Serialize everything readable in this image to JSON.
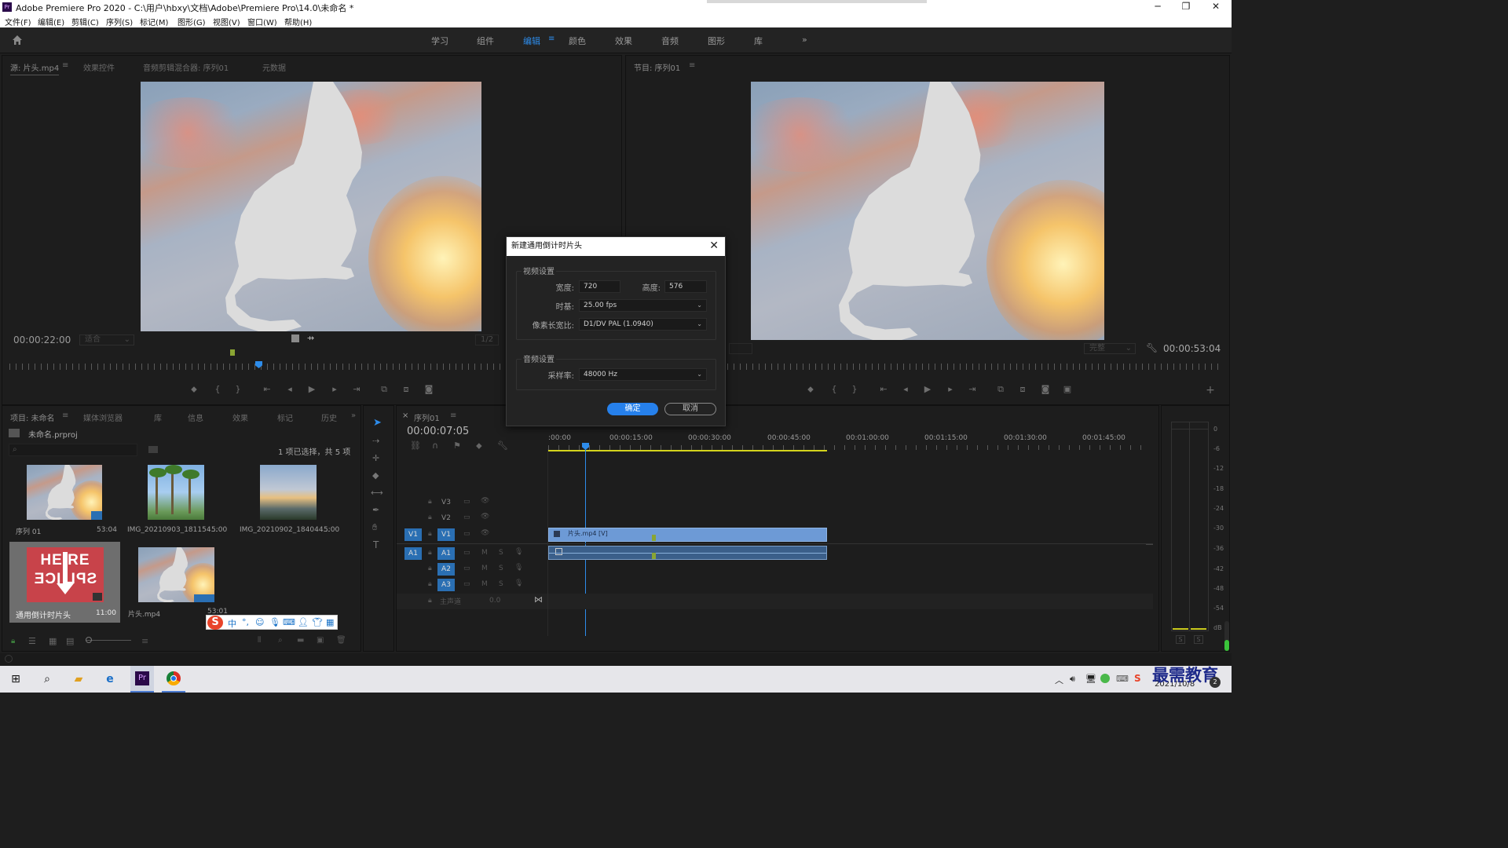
{
  "titlebar": {
    "title": "Adobe Premiere Pro 2020 - C:\\用户\\hbxy\\文档\\Adobe\\Premiere Pro\\14.0\\未命名 *",
    "app_icon": "Pr",
    "minimize": "─",
    "restore": "❐",
    "close": "✕"
  },
  "menubar": [
    "文件(F)",
    "编辑(E)",
    "剪辑(C)",
    "序列(S)",
    "标记(M)",
    "图形(G)",
    "视图(V)",
    "窗口(W)",
    "帮助(H)"
  ],
  "workspaces": {
    "tabs": [
      "学习",
      "组件",
      "编辑",
      "颜色",
      "效果",
      "音频",
      "图形",
      "库"
    ],
    "active": "编辑",
    "more": "»"
  },
  "source_panel": {
    "tabs": [
      "源: 片头.mp4",
      "效果控件",
      "音频剪辑混合器: 序列01",
      "元数据"
    ],
    "timecode": "00:00:22:00",
    "fit": "适合",
    "resolution": "1/2"
  },
  "program_panel": {
    "tab": "节目: 序列01",
    "timecode": "00:00:53:04",
    "resolution": "完整"
  },
  "dialog": {
    "title": "新建通用倒计时片头",
    "video_group": "视频设置",
    "width_label": "宽度:",
    "width_value": "720",
    "height_label": "高度:",
    "height_value": "576",
    "timebase_label": "时基:",
    "timebase_value": "25.00 fps",
    "par_label": "像素长宽比:",
    "par_value": "D1/DV PAL (1.0940)",
    "audio_group": "音频设置",
    "samplerate_label": "采样率:",
    "samplerate_value": "48000 Hz",
    "ok": "确定",
    "cancel": "取消"
  },
  "project_panel": {
    "tabs": [
      "项目: 未命名",
      "媒体浏览器",
      "库",
      "信息",
      "效果",
      "标记",
      "历史"
    ],
    "project_file": "未命名.prproj",
    "selection_info": "1 项已选择，共 5 项",
    "items": [
      {
        "name": "序列 01",
        "duration": "53:04"
      },
      {
        "name": "IMG_20210903_181154...",
        "duration": "5:00"
      },
      {
        "name": "IMG_20210902_184044...",
        "duration": "5:00"
      },
      {
        "name": "通用倒计时片头",
        "duration": "11:00"
      },
      {
        "name": "片头.mp4",
        "duration": "53:01"
      }
    ],
    "countdown_text_top": "HE RE",
    "countdown_text_bottom": "SPL ICE"
  },
  "timeline": {
    "tab": "序列01",
    "timecode": "00:00:07:05",
    "ruler": [
      ":00:00",
      "00:00:15:00",
      "00:00:30:00",
      "00:00:45:00",
      "00:01:00:00",
      "00:01:15:00",
      "00:01:30:00",
      "00:01:45:00"
    ],
    "tracks_video": [
      "V3",
      "V2",
      "V1"
    ],
    "tracks_audio": [
      "A1",
      "A2",
      "A3"
    ],
    "source_v": "V1",
    "source_a": "A1",
    "master_label": "主声道",
    "master_value": "0.0",
    "clip_video": "片头.mp4 [V]",
    "mute": "M",
    "solo": "S"
  },
  "meters": {
    "scale": [
      "0",
      "-6",
      "-12",
      "-18",
      "-24",
      "-30",
      "-36",
      "-42",
      "-48",
      "-54",
      "dB"
    ],
    "solo": "S"
  },
  "taskbar": {
    "date": "2021/10/8",
    "watermark": "最需教育",
    "premiere": "Pr"
  },
  "ime": {
    "lang": "中"
  },
  "colors": {
    "accent": "#2d8ceb",
    "clip_video": "#6d9ad6",
    "clip_audio": "#3b5f8a",
    "countdown_red": "#c8434a"
  }
}
